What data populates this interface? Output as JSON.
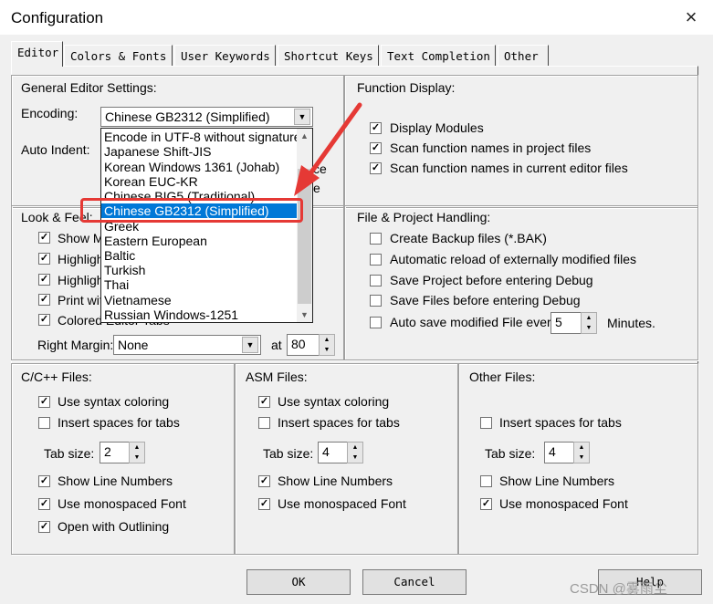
{
  "window": {
    "title": "Configuration",
    "close_icon": "×"
  },
  "tabs": [
    "Editor",
    "Colors & Fonts",
    "User Keywords",
    "Shortcut Keys",
    "Text Completion",
    "Other"
  ],
  "general": {
    "legend": "General Editor Settings:",
    "encoding_label": "Encoding:",
    "encoding_value": "Chinese GB2312 (Simplified)",
    "auto_indent_label": "Auto Indent:",
    "behind_fragments": [
      "ce",
      "e"
    ]
  },
  "encoding_dropdown": [
    "Encode in UTF-8 without signature",
    "Japanese Shift-JIS",
    "Korean Windows 1361 (Johab)",
    "Korean EUC-KR",
    "Chinese BIG5 (Traditional)",
    "Chinese GB2312 (Simplified)",
    "Greek",
    "Eastern European",
    "Baltic",
    "Turkish",
    "Thai",
    "Vietnamese",
    "Russian Windows-1251"
  ],
  "look_feel": {
    "legend": "Look & Feel:",
    "items": [
      "Show M",
      "Highligh",
      "Highligh",
      "Print wit",
      "Colored Editor Tabs"
    ],
    "right_margin_label": "Right Margin:",
    "right_margin_value": "None",
    "at_label": "at",
    "at_value": "80"
  },
  "function_display": {
    "legend": "Function Display:",
    "items": [
      "Display Modules",
      "Scan function names in project files",
      "Scan function names in current editor files"
    ]
  },
  "file_project": {
    "legend": "File & Project Handling:",
    "items": [
      "Create Backup files (*.BAK)",
      "Automatic reload of externally modified files",
      "Save Project before entering Debug",
      "Save Files before entering Debug",
      "Auto save modified File every"
    ],
    "autosave_value": "5",
    "minutes_label": "Minutes."
  },
  "c_files": {
    "legend": "C/C++ Files:",
    "syntax": "Use syntax coloring",
    "spaces": "Insert spaces for tabs",
    "tab_size_label": "Tab size:",
    "tab_size": "2",
    "line_numbers": "Show Line Numbers",
    "mono": "Use monospaced Font",
    "outlining": "Open with Outlining"
  },
  "asm_files": {
    "legend": "ASM Files:",
    "syntax": "Use syntax coloring",
    "spaces": "Insert spaces for tabs",
    "tab_size_label": "Tab size:",
    "tab_size": "4",
    "line_numbers": "Show Line Numbers",
    "mono": "Use monospaced Font"
  },
  "other_files": {
    "legend": "Other Files:",
    "spaces": "Insert spaces for tabs",
    "tab_size_label": "Tab size:",
    "tab_size": "4",
    "line_numbers": "Show Line Numbers",
    "mono": "Use monospaced Font"
  },
  "buttons": {
    "ok": "OK",
    "cancel": "Cancel",
    "help": "Help"
  },
  "watermark": "CSDN @雾雨尘",
  "checkmark": "✓",
  "dropdown_arrow": "▼",
  "spin_up": "▲",
  "spin_down": "▼",
  "accent_colors": {
    "selection": "#0078d7",
    "annotation": "#e53935"
  }
}
